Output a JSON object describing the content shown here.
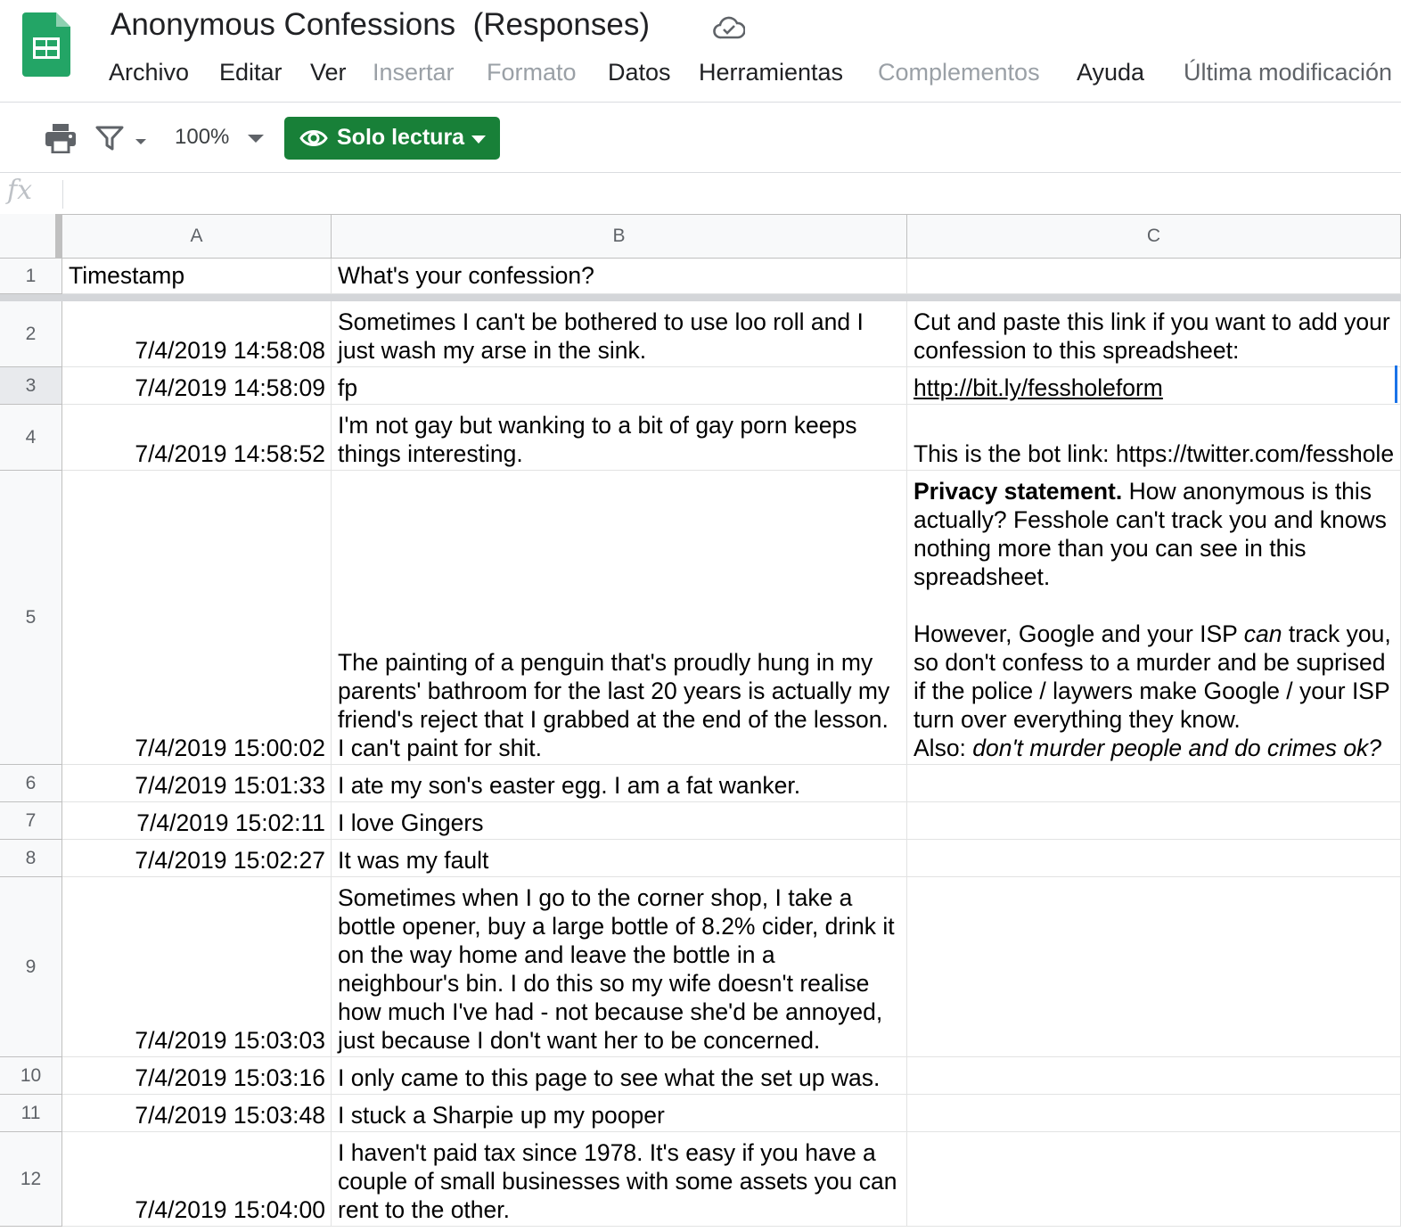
{
  "doc": {
    "title": "Anonymous Confessions  (Responses)"
  },
  "menu": {
    "items": [
      {
        "label": "Archivo",
        "enabled": true
      },
      {
        "label": "Editar",
        "enabled": true
      },
      {
        "label": "Ver",
        "enabled": true
      },
      {
        "label": "Insertar",
        "enabled": false
      },
      {
        "label": "Formato",
        "enabled": false
      },
      {
        "label": "Datos",
        "enabled": true
      },
      {
        "label": "Herramientas",
        "enabled": true
      },
      {
        "label": "Complementos",
        "enabled": false
      },
      {
        "label": "Ayuda",
        "enabled": true
      }
    ],
    "last_modified": "Última modificación"
  },
  "toolbar": {
    "zoom": "100%",
    "mode_label": "Solo lectura",
    "mode_color": "#188038"
  },
  "formula_bar": {
    "fx_label": "fx",
    "value": ""
  },
  "grid": {
    "columns": [
      "A",
      "B",
      "C"
    ],
    "rows": [
      {
        "num": "1",
        "a": "Timestamp",
        "b": "What's your confession?",
        "c": ""
      },
      {
        "num": "2",
        "a": "7/4/2019 14:58:08",
        "b": "Sometimes I can't be bothered to use loo roll and I just wash my arse in the sink.",
        "c": "Cut and paste this link if you want to add your confession to this spreadsheet:"
      },
      {
        "num": "3",
        "a": "7/4/2019 14:58:09",
        "b": "fp",
        "c": "http://bit.ly/fessholeform"
      },
      {
        "num": "4",
        "a": "7/4/2019 14:58:52",
        "b": "I'm not gay but wanking to a bit of gay porn keeps things interesting.",
        "c": "This is the bot link: https://twitter.com/fesshole"
      },
      {
        "num": "5",
        "a": "7/4/2019 15:00:02",
        "b": "The painting of a penguin that's proudly hung in my parents' bathroom for the last 20 years is actually my friend's reject that I grabbed at the end of the lesson. I can't paint for shit.",
        "c_parts": {
          "bold": "Privacy statement.",
          "p1": " How anonymous is this actually? Fesshole can't track you and knows nothing more than you can see in this spreadsheet.",
          "p2a": "However, Google and your ISP ",
          "p2i": "can",
          "p2b": " track you, so don't confess to a murder and be suprised if the police / laywers make Google / your ISP turn over everything they know.",
          "p3a": "Also: ",
          "p3i": "don't murder people and do crimes ok?"
        }
      },
      {
        "num": "6",
        "a": "7/4/2019 15:01:33",
        "b": "I ate my son's easter egg. I am a fat wanker.",
        "c": ""
      },
      {
        "num": "7",
        "a": "7/4/2019 15:02:11",
        "b": "I love Gingers",
        "c": ""
      },
      {
        "num": "8",
        "a": "7/4/2019 15:02:27",
        "b": "It was my fault",
        "c": ""
      },
      {
        "num": "9",
        "a": "7/4/2019 15:03:03",
        "b": "Sometimes when I go to the corner shop, I take a bottle opener, buy a large bottle of 8.2% cider, drink it on the way home and leave the bottle in a neighbour's bin. I do this so my wife doesn't realise how much I've had - not because she'd be annoyed, just because I don't want her to be concerned.",
        "c": ""
      },
      {
        "num": "10",
        "a": "7/4/2019 15:03:16",
        "b": "I only came to this page to see what the set up was.",
        "c": ""
      },
      {
        "num": "11",
        "a": "7/4/2019 15:03:48",
        "b": "I stuck a Sharpie up my pooper",
        "c": ""
      },
      {
        "num": "12",
        "a": "7/4/2019 15:04:00",
        "b": "I haven't paid tax since 1978. It's easy if you have a couple of small businesses with some assets you can rent to the other.",
        "c": ""
      }
    ]
  }
}
